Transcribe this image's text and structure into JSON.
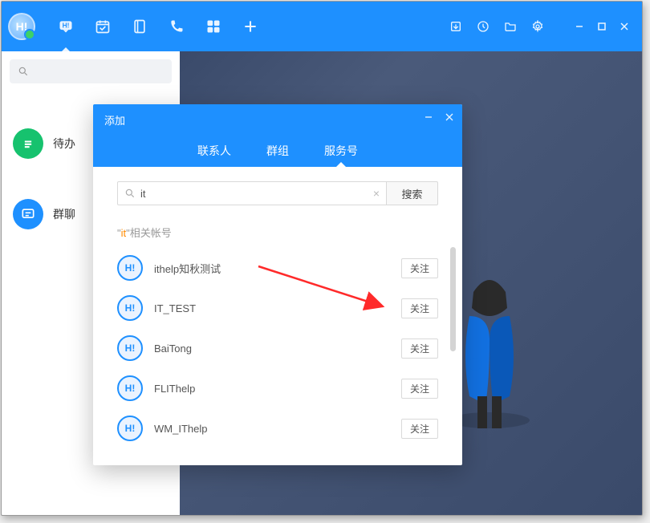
{
  "titlebar": {
    "avatar_label": "H!"
  },
  "sidebar": {
    "items": [
      {
        "label": "待办"
      },
      {
        "label": "群聊"
      }
    ]
  },
  "modal": {
    "title": "添加",
    "tabs": [
      {
        "label": "联系人"
      },
      {
        "label": "群组"
      },
      {
        "label": "服务号"
      }
    ],
    "active_tab_index": 2,
    "search_value": "it",
    "search_button": "搜索",
    "related_prefix": "\"",
    "related_keyword": "it",
    "related_suffix": "\"相关帐号",
    "results": [
      {
        "name": "ithelp知秋测试",
        "action": "关注"
      },
      {
        "name": "IT_TEST",
        "action": "关注"
      },
      {
        "name": "BaiTong",
        "action": "关注"
      },
      {
        "name": "FLIThelp",
        "action": "关注"
      },
      {
        "name": "WM_IThelp",
        "action": "关注"
      }
    ]
  }
}
